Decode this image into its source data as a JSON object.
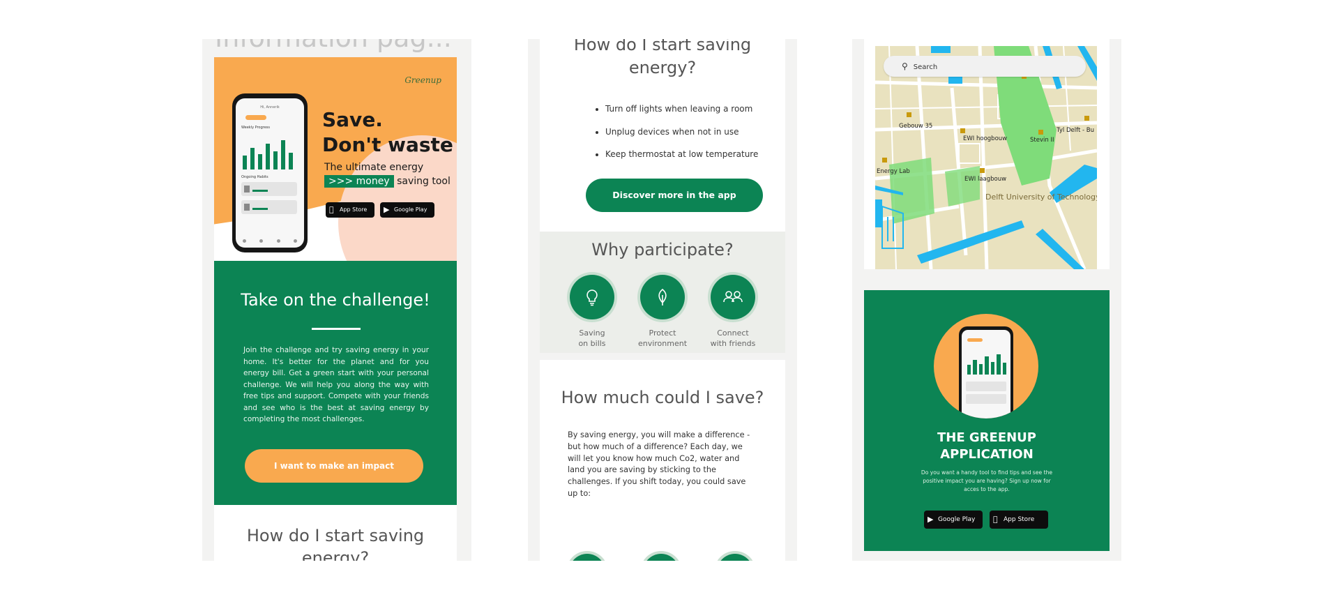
{
  "panel1": {
    "title": "Information pag...",
    "hero": {
      "logo": "Greenup",
      "headline_line1": "Save.",
      "headline_line2": "Don't waste",
      "sub_line1": "The ultimate energy",
      "sub_tag": ">>> money",
      "sub_line2": "saving tool",
      "app_store": "App Store",
      "google_play": "Google Play"
    },
    "challenge": {
      "title": "Take on the challenge!",
      "body": "Join the challenge and try saving energy in your home. It's better for the planet and for you energy bill. Get a green start with your personal challenge. We will help you along the way with free tips and support. Compete with your friends and see who is the best at saving energy by completing the most challenges.",
      "button": "I want to make an impact"
    },
    "next_heading": "How do I start saving energy?"
  },
  "panel2": {
    "heading": "How do I start saving energy?",
    "tips": [
      "Turn off lights when leaving a room",
      "Unplug devices when not in use",
      "Keep thermostat at low temperature"
    ],
    "button": "Discover more in the app",
    "why": {
      "title": "Why participate?",
      "items": [
        {
          "line1": "Saving",
          "line2": "on bills",
          "icon": "lightbulb-icon"
        },
        {
          "line1": "Protect",
          "line2": "environment",
          "icon": "leaf-icon"
        },
        {
          "line1": "Connect",
          "line2": "with friends",
          "icon": "people-icon"
        }
      ]
    },
    "save": {
      "title": "How much could I save?",
      "body": "By saving energy, you will make a difference - but how much of a difference? Each day, we will let you know how much Co2, water and land you are saving by sticking to the challenges. If you shift today, you could save up to:"
    }
  },
  "panel3": {
    "map": {
      "search_placeholder": "Search",
      "labels": [
        "Delft University of Technology",
        "EWI hoogbouw",
        "Gebouw 35",
        "Stevin II",
        "Tyl Delft - Bu",
        "Energy Lab",
        "EWI laagbouw"
      ]
    },
    "app": {
      "title_line1": "THE GREENUP",
      "title_line2": "APPLICATION",
      "body": "Do you want a handy tool to find tips and see the positive impact you are having? Sign up now for acces to the app.",
      "google_play": "Google Play",
      "app_store": "App Store"
    }
  },
  "colors": {
    "green": "#0c8454",
    "orange": "#f9a94f",
    "panel_bg": "#f3f3f2",
    "map_land": "#e9e2bf",
    "map_water": "#22b6ef",
    "map_park": "#7fdc7a"
  },
  "mockup": {
    "greeting": "Hi, Annerik",
    "progress_label": "Weekly Progress",
    "habits_label": "Ongoing Habits",
    "bars": [
      0.45,
      0.7,
      0.5,
      0.85,
      0.6,
      0.95,
      0.55
    ]
  }
}
